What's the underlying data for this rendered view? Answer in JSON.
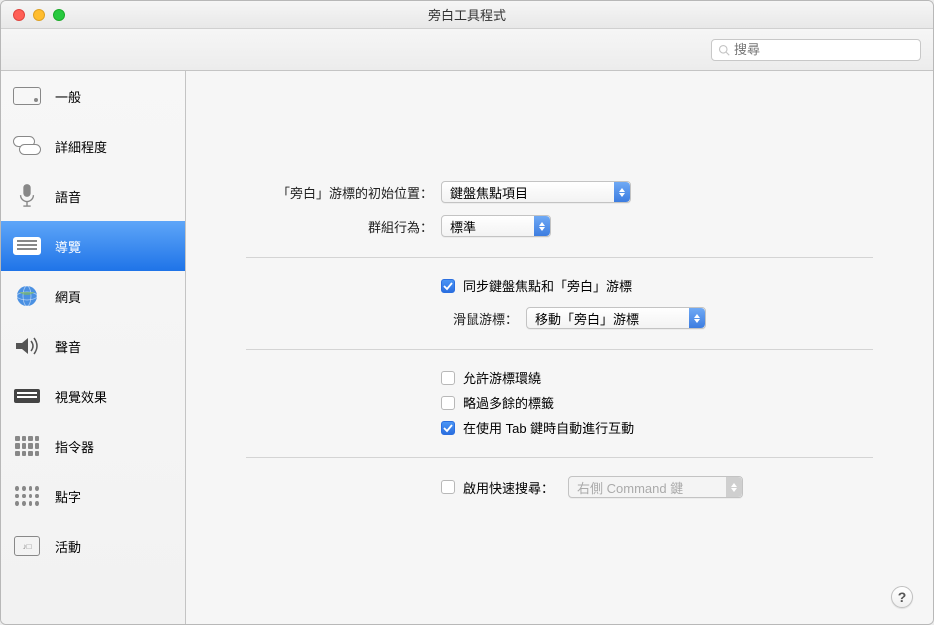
{
  "window_title": "旁白工具程式",
  "search": {
    "placeholder": "搜尋"
  },
  "sidebar": {
    "items": [
      {
        "label": "一般"
      },
      {
        "label": "詳細程度"
      },
      {
        "label": "語音"
      },
      {
        "label": "導覽"
      },
      {
        "label": "網頁"
      },
      {
        "label": "聲音"
      },
      {
        "label": "視覺效果"
      },
      {
        "label": "指令器"
      },
      {
        "label": "點字"
      },
      {
        "label": "活動"
      }
    ],
    "selected_index": 3
  },
  "settings": {
    "initial_cursor_label": "「旁白」游標的初始位置：",
    "initial_cursor_value": "鍵盤焦點項目",
    "group_behavior_label": "群組行為：",
    "group_behavior_value": "標準",
    "sync_checkbox_label": "同步鍵盤焦點和「旁白」游標",
    "sync_checkbox_checked": true,
    "mouse_cursor_label": "滑鼠游標：",
    "mouse_cursor_value": "移動「旁白」游標",
    "allow_wrap_label": "允許游標環繞",
    "allow_wrap_checked": false,
    "skip_redundant_label": "略過多餘的標籤",
    "skip_redundant_checked": false,
    "auto_tab_label": "在使用 Tab 鍵時自動進行互動",
    "auto_tab_checked": true,
    "quicknav_label": "啟用快速搜尋：",
    "quicknav_checked": false,
    "quicknav_value": "右側 Command 鍵"
  },
  "help_label": "?"
}
